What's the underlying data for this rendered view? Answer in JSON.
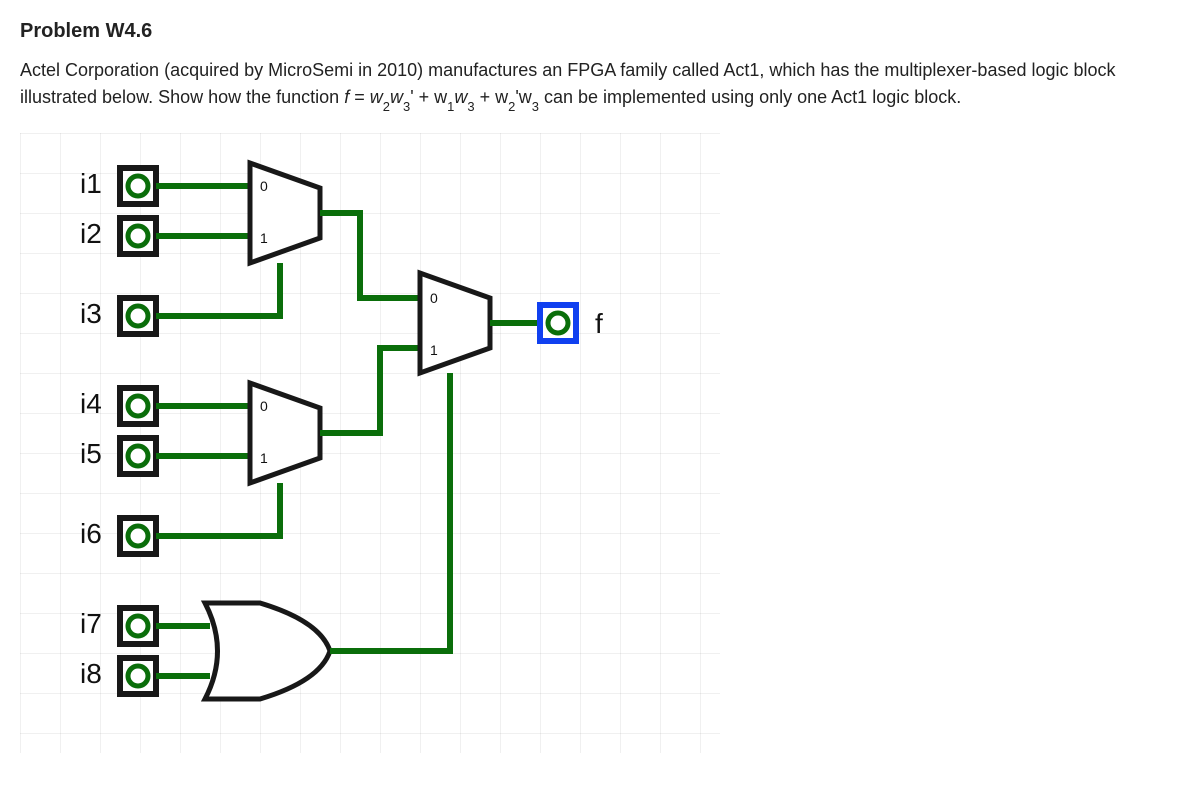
{
  "problem_title": "Problem W4.6",
  "problem_text_before": "Actel Corporation (acquired by MicroSemi in 2010) manufactures an FPGA family called Act1, which has the multiplexer-based logic block illustrated below. Show how the function ",
  "problem_expr_lhs": "f",
  "problem_expr_eq": " = ",
  "expr_terms": [
    "w",
    "2",
    "w",
    "3",
    "' + w",
    "1",
    "w",
    "3",
    " + w",
    "2",
    "'w",
    "3"
  ],
  "problem_text_after": " can be implemented using only one Act1 logic block.",
  "inputs": [
    "i1",
    "i2",
    "i3",
    "i4",
    "i5",
    "i6",
    "i7",
    "i8"
  ],
  "output_label": "f",
  "mux_sel": {
    "zero": "0",
    "one": "1"
  },
  "chart_data": {
    "type": "diagram",
    "description": "Act1 multiplexer-based logic block",
    "components": [
      {
        "name": "mux_top",
        "type": "2:1 mux",
        "inputs": [
          "i1",
          "i2"
        ],
        "select": "i3"
      },
      {
        "name": "mux_bot",
        "type": "2:1 mux",
        "inputs": [
          "i4",
          "i5"
        ],
        "select": "i6"
      },
      {
        "name": "or_gate",
        "type": "OR",
        "inputs": [
          "i7",
          "i8"
        ]
      },
      {
        "name": "mux_out",
        "type": "2:1 mux",
        "inputs": [
          "mux_top",
          "mux_bot"
        ],
        "select": "or_gate",
        "output": "f"
      }
    ]
  }
}
